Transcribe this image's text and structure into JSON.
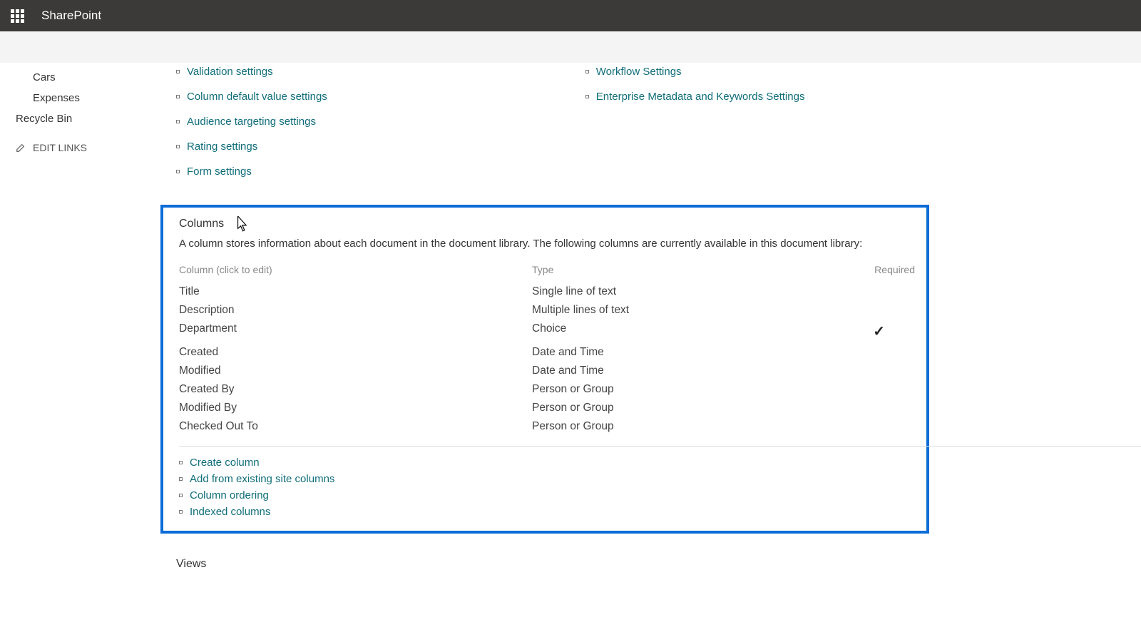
{
  "header": {
    "brand": "SharePoint"
  },
  "sidebar": {
    "items": [
      {
        "label": "Cars"
      },
      {
        "label": "Expenses"
      }
    ],
    "recycle": "Recycle Bin",
    "edit_links": "EDIT LINKS"
  },
  "settings_left": [
    "Validation settings",
    "Column default value settings",
    "Audience targeting settings",
    "Rating settings",
    "Form settings"
  ],
  "settings_right": [
    "Workflow Settings",
    "Enterprise Metadata and Keywords Settings"
  ],
  "columns": {
    "title": "Columns",
    "desc": "A column stores information about each document in the document library. The following columns are currently available in this document library:",
    "head_name": "Column (click to edit)",
    "head_type": "Type",
    "head_req": "Required",
    "rows": [
      {
        "name": "Title",
        "type": "Single line of text",
        "required": false
      },
      {
        "name": "Description",
        "type": "Multiple lines of text",
        "required": false
      },
      {
        "name": "Department",
        "type": "Choice",
        "required": true
      },
      {
        "name": "Created",
        "type": "Date and Time",
        "required": false
      },
      {
        "name": "Modified",
        "type": "Date and Time",
        "required": false
      },
      {
        "name": "Created By",
        "type": "Person or Group",
        "required": false
      },
      {
        "name": "Modified By",
        "type": "Person or Group",
        "required": false
      },
      {
        "name": "Checked Out To",
        "type": "Person or Group",
        "required": false
      }
    ],
    "actions": [
      "Create column",
      "Add from existing site columns",
      "Column ordering",
      "Indexed columns"
    ]
  },
  "views": {
    "title": "Views"
  }
}
